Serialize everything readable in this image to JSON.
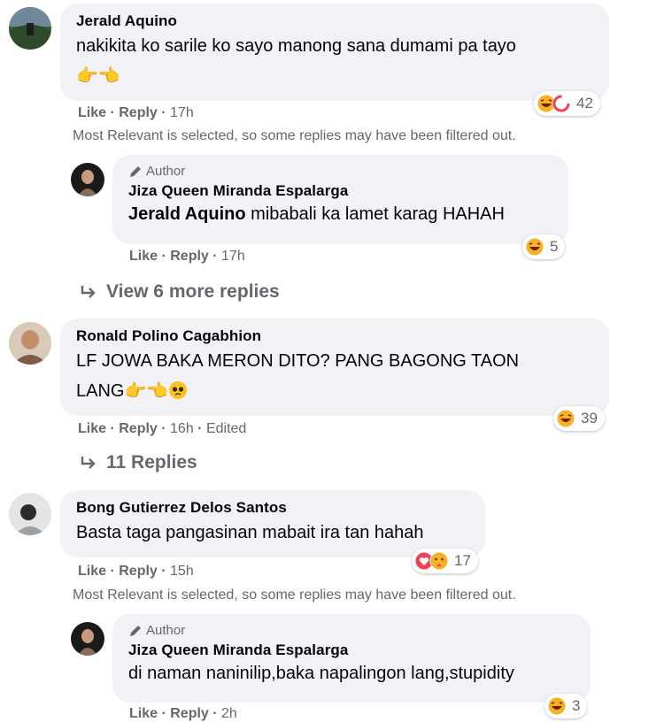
{
  "comments": [
    {
      "name": "Jerald Aquino",
      "text": "nakikita ko sarile ko sayo manong sana dumami pa tayo",
      "emoji_line": "👉👈",
      "actions": {
        "like": "Like",
        "reply": "Reply",
        "time": "17h"
      },
      "reactions": [
        "haha",
        "love"
      ],
      "reaction_count": "42"
    },
    {
      "name": "Ronald Polino Cagabhion",
      "text": "LF JOWA BAKA MERON DITO? PANG BAGONG TAON",
      "text2": "LANG",
      "actions": {
        "like": "Like",
        "reply": "Reply",
        "time": "16h",
        "edited": "Edited"
      },
      "reactions": [
        "haha"
      ],
      "reaction_count": "39"
    },
    {
      "name": "Bong Gutierrez Delos Santos",
      "text": "Basta taga pangasinan mabait ira tan hahah",
      "actions": {
        "like": "Like",
        "reply": "Reply",
        "time": "15h"
      },
      "reactions": [
        "love",
        "care"
      ],
      "reaction_count": "17"
    }
  ],
  "replies": [
    {
      "author_label": "Author",
      "name": "Jiza Queen Miranda Espalarga",
      "mention": "Jerald Aquino",
      "text": "mibabali ka lamet karag HAHAH",
      "actions": {
        "like": "Like",
        "reply": "Reply",
        "time": "17h"
      },
      "reaction_count": "5"
    },
    {
      "author_label": "Author",
      "name": "Jiza Queen Miranda Espalarga",
      "text": "di naman naninilip,baka napalingon lang,stupidity",
      "actions": {
        "like": "Like",
        "reply": "Reply",
        "time": "2h"
      },
      "reaction_count": "3"
    }
  ],
  "filter_note": "Most Relevant is selected, so some replies may have been filtered out.",
  "view_more_replies": "View 6 more replies",
  "replies_count_link": "11 Replies",
  "separator": " · ",
  "colors": {
    "bubble": "#f0f2f5",
    "meta": "#65676b",
    "haha": "#f7b125",
    "love": "#f33e58"
  }
}
